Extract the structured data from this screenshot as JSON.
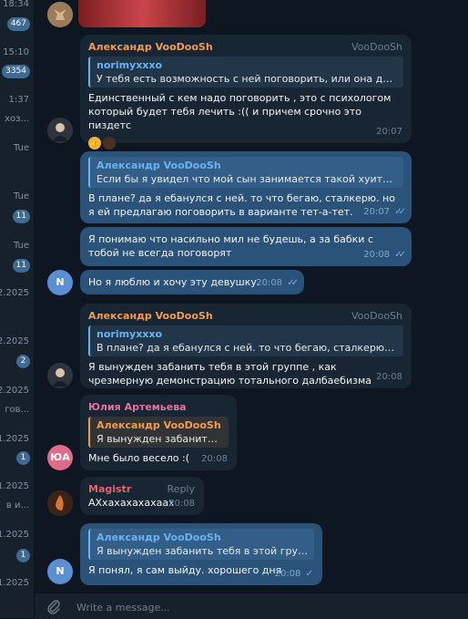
{
  "sidebar": {
    "rows": [
      {
        "text": "18:34",
        "badge": "467"
      },
      {
        "text": "15:10",
        "badge": "3354"
      },
      {
        "text": "1:37",
        "preview": "хоз..."
      },
      {
        "text": "Tue"
      },
      {
        "text": "Tue",
        "badge": "11"
      },
      {
        "text": "Tue",
        "badge": "11"
      },
      {
        "text": "2.2025"
      },
      {
        "text": "2.2025",
        "badge": "2"
      },
      {
        "text": "2.2025",
        "preview": "гов..."
      },
      {
        "text": "1.2025",
        "badge": "1"
      },
      {
        "text": "1.2025",
        "preview": "в и..."
      },
      {
        "text": "1.2025",
        "badge": "1"
      },
      {
        "text": "1.2025"
      }
    ]
  },
  "messages": {
    "m1": {
      "sender": "Александр VooDooSh",
      "via": "VooDooSh",
      "quote_name": "norimyxxxo",
      "quote_text": "У тебя есть возможность с ней поговорить, или она для те...",
      "body": "Единственный с кем надо поговорить , это с психологом который будет тебя лечить :(( и причем срочно это пиздетс",
      "time": "20:07"
    },
    "m2": {
      "quote_name": "Александр VooDooSh",
      "quote_text": "Если бы я увидел что мой сын занимается такой хуитой , мн...",
      "body": "В плане? да я ебанулся с ней. то что бегаю, сталкерю. но я ей предлагаю поговорить в варианте тет-а-тет.",
      "time": "20:07"
    },
    "m3": {
      "body": "Я понимаю что насильно мил не будешь, а за бабки с тобой не всегда поговорят",
      "time": "20:08"
    },
    "m4": {
      "body": "Но я люблю и хочу эту девушку.",
      "time": "20:08"
    },
    "m5": {
      "sender": "Александр VooDooSh",
      "via": "VooDooSh",
      "quote_name": "norimyxxxo",
      "quote_text": "В плане? да я ебанулся с ней. то что бегаю, сталкерю. но я е...",
      "body": "Я вынужден забанить тебя в этой группе , как чрезмерную демонстрацию тотального далбаебизма",
      "time": "20:08"
    },
    "m6": {
      "sender": "Юлия Артемьева",
      "quote_name": "Александр VooDooSh",
      "quote_text": "Я вынужден забанить те...",
      "body": "Мне было весело :(",
      "time": "20:08"
    },
    "m7": {
      "sender": "Magistr",
      "reply": "Reply",
      "body": "АХхахахахахаах",
      "time": "20:08"
    },
    "m8": {
      "quote_name": "Александр VooDooSh",
      "quote_text": "Я вынужден забанить тебя в этой группе ,...",
      "body": "Я понял, я сам выйду. хорошего дня",
      "time": "20:08"
    }
  },
  "avatars": {
    "n": "N",
    "ua": "ЮА"
  },
  "compose": {
    "placeholder": "Write a message..."
  },
  "colors": {
    "bg": "#0e1621",
    "incoming": "#182533",
    "outgoing": "#2b5278",
    "name_orange": "#f19c4e",
    "name_pink": "#e5739d",
    "name_red": "#e06666",
    "link_blue": "#6ab3f3"
  },
  "icons": {
    "read": "double-check-icon",
    "sent": "check-icon",
    "attach": "paperclip-icon"
  }
}
